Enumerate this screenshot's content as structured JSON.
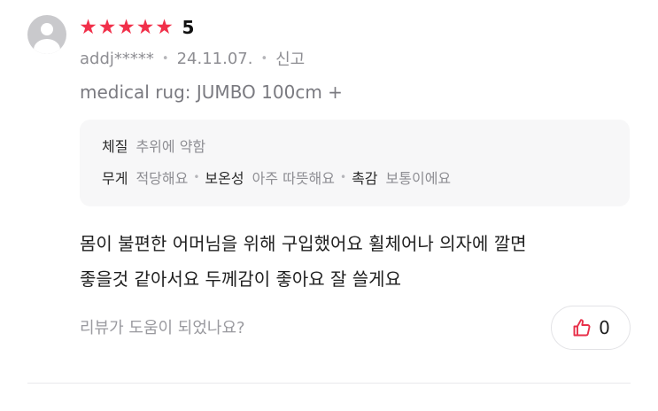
{
  "review": {
    "rating": 5,
    "rating_label": "5",
    "star_glyph": "★",
    "star_color": "#f1304a",
    "author": "addj*****",
    "date": "24.11.07.",
    "report_label": "신고",
    "product_option": "medical rug: JUMBO 100cm +",
    "attributes": [
      {
        "key": "체질",
        "value": "추위에 약함"
      },
      {
        "key": "무게",
        "value": "적당해요"
      },
      {
        "key": "보온성",
        "value": "아주 따뜻해요"
      },
      {
        "key": "촉감",
        "value": "보통이에요"
      }
    ],
    "body_lines": [
      "몸이 불편한 어머님을 위해 구입했어요  휠체어나 의자에 깔면",
      "좋을것 같아서요 두께감이 좋아요 잘 쓸게요"
    ],
    "helpful_question": "리뷰가 도움이 되었나요?",
    "like_count": "0",
    "like_icon": "thumbs-up-icon",
    "accent_color": "#e8304a"
  }
}
